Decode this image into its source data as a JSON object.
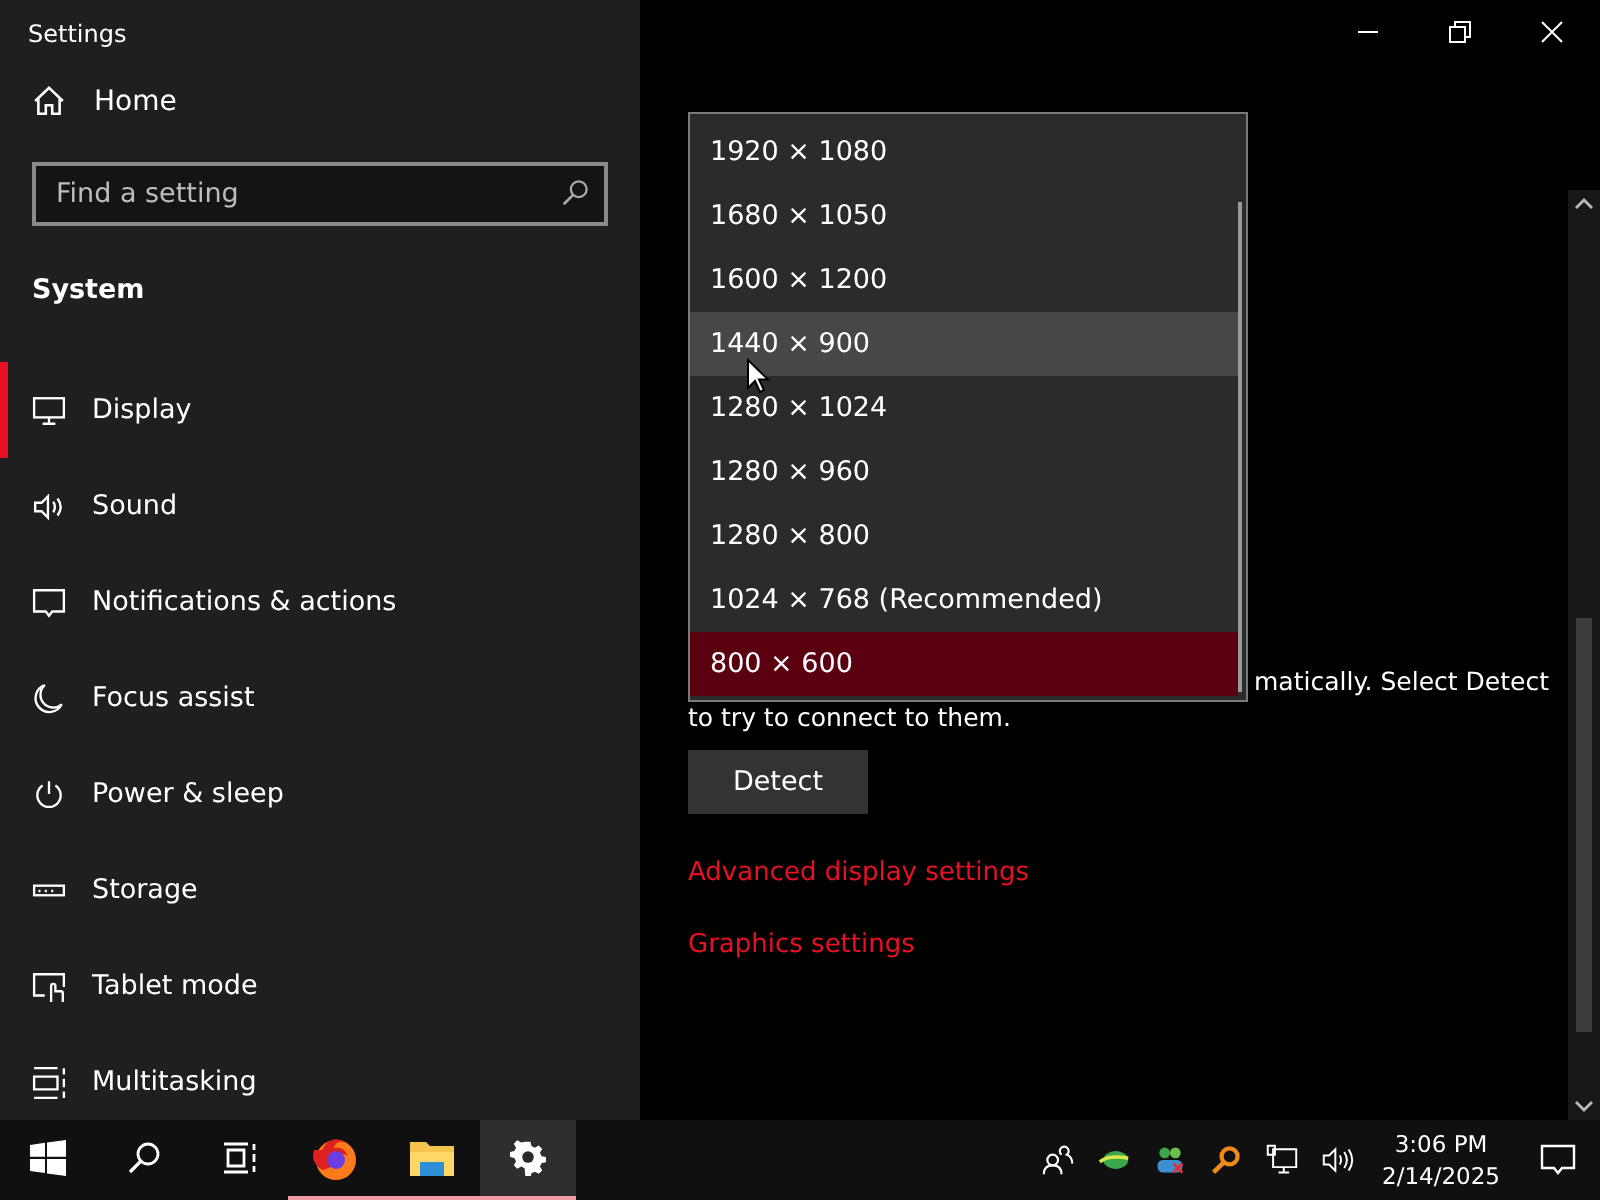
{
  "window": {
    "title": "Settings"
  },
  "sidebar": {
    "home": "Home",
    "search": {
      "placeholder": "Find a setting"
    },
    "section": "System",
    "items": [
      {
        "label": "Display",
        "kind": "display",
        "selected": true
      },
      {
        "label": "Sound",
        "kind": "sound",
        "selected": false
      },
      {
        "label": "Notifications & actions",
        "kind": "notifications",
        "selected": false
      },
      {
        "label": "Focus assist",
        "kind": "moon",
        "selected": false
      },
      {
        "label": "Power & sleep",
        "kind": "power",
        "selected": false
      },
      {
        "label": "Storage",
        "kind": "storage",
        "selected": false
      },
      {
        "label": "Tablet mode",
        "kind": "tablet",
        "selected": false
      },
      {
        "label": "Multitasking",
        "kind": "multitask",
        "selected": false
      }
    ]
  },
  "content": {
    "paragraph": "matically. Select Detect to try to connect to them.",
    "detect_button": "Detect",
    "links": [
      "Advanced display settings",
      "Graphics settings"
    ]
  },
  "dropdown": {
    "options": [
      {
        "label": "1920 × 1080",
        "selected": false,
        "hovered": false
      },
      {
        "label": "1680 × 1050",
        "selected": false,
        "hovered": false
      },
      {
        "label": "1600 × 1200",
        "selected": false,
        "hovered": false
      },
      {
        "label": "1440 × 900",
        "selected": false,
        "hovered": true
      },
      {
        "label": "1280 × 1024",
        "selected": false,
        "hovered": false
      },
      {
        "label": "1280 × 960",
        "selected": false,
        "hovered": false
      },
      {
        "label": "1280 × 800",
        "selected": false,
        "hovered": false
      },
      {
        "label": "1024 × 768 (Recommended)",
        "selected": false,
        "hovered": false
      },
      {
        "label": "800 × 600",
        "selected": true,
        "hovered": false
      }
    ]
  },
  "taskbar": {
    "apps": [
      {
        "kind": "start",
        "open": false,
        "active": false
      },
      {
        "kind": "search",
        "open": false,
        "active": false
      },
      {
        "kind": "taskview",
        "open": false,
        "active": false
      },
      {
        "kind": "browser",
        "open": true,
        "active": false
      },
      {
        "kind": "folder",
        "open": true,
        "active": false
      },
      {
        "kind": "settings",
        "open": true,
        "active": true
      }
    ],
    "time": "3:06 PM",
    "date": "2/14/2025"
  }
}
